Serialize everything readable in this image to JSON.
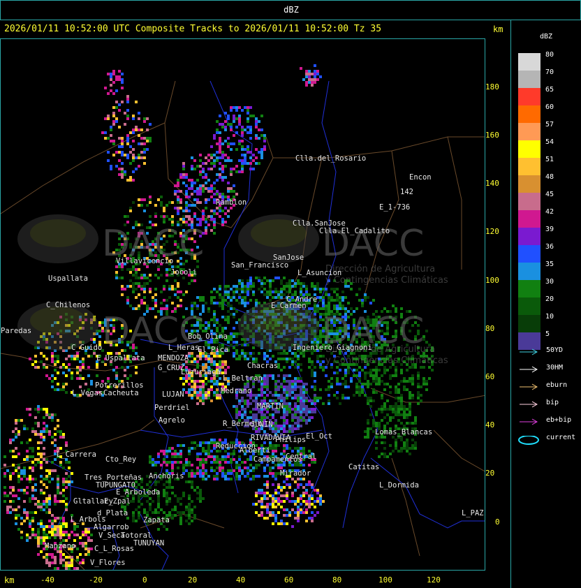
{
  "window": {
    "title": "dBZ"
  },
  "header": {
    "text": "2026/01/11 10:52:00 UTC Composite Tracks to 2026/01/11 10:52:00 Tz 35",
    "km_label": "km"
  },
  "axes": {
    "y_ticks": [
      "180",
      "160",
      "140",
      "120",
      "100",
      "80",
      "60",
      "40",
      "20",
      "0"
    ],
    "x_ticks": [
      "-40",
      "-20",
      "0",
      "20",
      "40",
      "60",
      "80",
      "100",
      "120"
    ],
    "x_km_label": "km"
  },
  "legend": {
    "unit": "dBZ",
    "levels": [
      {
        "label": "80",
        "color": "#d8d8d8"
      },
      {
        "label": "70",
        "color": "#b5b5b5"
      },
      {
        "label": "65",
        "color": "#ff3a2a"
      },
      {
        "label": "60",
        "color": "#ff6a00"
      },
      {
        "label": "57",
        "color": "#ff9a55"
      },
      {
        "label": "54",
        "color": "#ffff00"
      },
      {
        "label": "51",
        "color": "#ffc030"
      },
      {
        "label": "48",
        "color": "#d89030"
      },
      {
        "label": "45",
        "color": "#c86c8c"
      },
      {
        "label": "42",
        "color": "#d01890"
      },
      {
        "label": "39",
        "color": "#7a1ad0"
      },
      {
        "label": "36",
        "color": "#2050ff"
      },
      {
        "label": "35",
        "color": "#1a90e0"
      },
      {
        "label": "30",
        "color": "#118011"
      },
      {
        "label": "20",
        "color": "#0a5a0a"
      },
      {
        "label": "10",
        "color": "#083d08"
      },
      {
        "label": "5",
        "color": "#4a3a98"
      }
    ],
    "tracks": [
      {
        "label": "50YD",
        "color": "#40d0e0"
      },
      {
        "label": "30HM",
        "color": "#ffffff"
      },
      {
        "label": "eburn",
        "color": "#f0c070"
      },
      {
        "label": "bip",
        "color": "#ffd0e0"
      },
      {
        "label": "eb+bip",
        "color": "#e040e0"
      },
      {
        "label": "current",
        "color": "#20e0ff"
      }
    ]
  },
  "watermark": {
    "brand": "DACC",
    "line1": "Dirección de Agricultura",
    "line2": "y Contingencias Climáticas"
  },
  "places": [
    {
      "name": "Clla.del_Rosario"
    },
    {
      "name": "Encon"
    },
    {
      "name": "142"
    },
    {
      "name": "E_1-736"
    },
    {
      "name": "Ramblon"
    },
    {
      "name": "Clla.SanJose"
    },
    {
      "name": "Clla.El_Cadalito"
    },
    {
      "name": "Villavicencio"
    },
    {
      "name": "Jocoli"
    },
    {
      "name": "San_Francisco"
    },
    {
      "name": "SanJose"
    },
    {
      "name": "L_Asuncion"
    },
    {
      "name": "Uspallata"
    },
    {
      "name": "C_Andre"
    },
    {
      "name": "E_Carmen"
    },
    {
      "name": "C_Chilenos"
    },
    {
      "name": "Paredas"
    },
    {
      "name": "C_Guido"
    },
    {
      "name": "E_Uspallata"
    },
    {
      "name": "L_Heras"
    },
    {
      "name": "MENDOZA"
    },
    {
      "name": "G_CRUZ"
    },
    {
      "name": "Bob_Olina"
    },
    {
      "name": "El_Pica"
    },
    {
      "name": "Ingeniero_Giagnoni"
    },
    {
      "name": "Luzuriaga"
    },
    {
      "name": "L_Beltran"
    },
    {
      "name": "Chacras"
    },
    {
      "name": "Medrano"
    },
    {
      "name": "Potrerillos"
    },
    {
      "name": "L_Vegas"
    },
    {
      "name": "Cacheuta"
    },
    {
      "name": "LUJAN"
    },
    {
      "name": "Perdriel"
    },
    {
      "name": "Agrelo"
    },
    {
      "name": "MARTIN"
    },
    {
      "name": "JUNIN"
    },
    {
      "name": "R_Bermejo"
    },
    {
      "name": "RIVADAVIA"
    },
    {
      "name": "Philips"
    },
    {
      "name": "El_Oct"
    },
    {
      "name": "Lomas_Blancas"
    },
    {
      "name": "Reduccion"
    },
    {
      "name": "Alberti"
    },
    {
      "name": "Campamentos"
    },
    {
      "name": "Central"
    },
    {
      "name": "L_Carrera"
    },
    {
      "name": "Cto_Rey"
    },
    {
      "name": "Anchoris"
    },
    {
      "name": "Catitas"
    },
    {
      "name": "Mirador"
    },
    {
      "name": "Tres_Porteñas"
    },
    {
      "name": "TUPUNGATO"
    },
    {
      "name": "E_Arboleda"
    },
    {
      "name": "L_Dormida"
    },
    {
      "name": "Gltallary"
    },
    {
      "name": "E_Zpal"
    },
    {
      "name": "L_Arbols"
    },
    {
      "name": "d_Plata"
    },
    {
      "name": "Zapata"
    },
    {
      "name": "Algarrob"
    },
    {
      "name": "V_Seca"
    },
    {
      "name": "Totoral"
    },
    {
      "name": "TUNUYAN"
    },
    {
      "name": "C_L_Rosas"
    },
    {
      "name": "Manzano"
    },
    {
      "name": "V_Flores"
    },
    {
      "name": "L_PAZ"
    }
  ]
}
